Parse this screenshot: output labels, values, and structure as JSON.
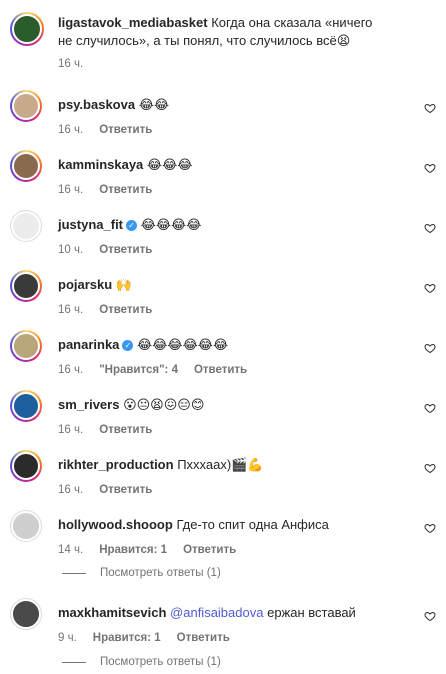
{
  "caption": {
    "username": "ligastavok_mediabasket",
    "text": "Когда она сказала «ничего не случилось», а ты понял, что случилось всё",
    "emoji": "😫",
    "time": "16 ч."
  },
  "comments": [
    {
      "username": "psy.baskova",
      "text": "",
      "emoji": "😂😂",
      "time": "16 ч.",
      "likes": "",
      "reply": "Ответить",
      "avatar_color": "#c9a98c"
    },
    {
      "username": "kamminskaya",
      "text": "",
      "emoji": "😂😂😂",
      "time": "16 ч.",
      "likes": "",
      "reply": "Ответить",
      "avatar_color": "#8a6a4e"
    },
    {
      "username": "justyna_fit",
      "text": "",
      "emoji": "😂😂😂😂",
      "time": "10 ч.",
      "likes": "",
      "reply": "Ответить",
      "avatar_color": "#ececec"
    },
    {
      "username": "pojarsku",
      "text": "",
      "emoji": "🙌",
      "time": "16 ч.",
      "likes": "",
      "reply": "Ответить",
      "avatar_color": "#3a3a3a"
    },
    {
      "username": "panarinka",
      "text": "",
      "emoji": "😂😂😂😂😂😂",
      "time": "16 ч.",
      "likes": "\"Нравится\": 4",
      "reply": "Ответить",
      "avatar_color": "#b8a57a"
    },
    {
      "username": "sm_rivers",
      "text": "",
      "emoji": "😮😐😫😖😑😊",
      "time": "16 ч.",
      "likes": "",
      "reply": "Ответить",
      "avatar_color": "#1d5f9c"
    },
    {
      "username": "rikhter_production",
      "text": "Пхххаах)",
      "emoji": "🎬💪",
      "time": "16 ч.",
      "likes": "",
      "reply": "Ответить",
      "avatar_color": "#2b2b2b"
    },
    {
      "username": "hollywood.shooop",
      "text": "Где-то спит одна Анфиса",
      "emoji": "",
      "time": "14 ч.",
      "likes": "Нравится: 1",
      "reply": "Ответить",
      "avatar_color": "#cfcfcf"
    },
    {
      "username": "maxkhamitsevich",
      "mention": "@anfisaibadova",
      "text": "ержан вставай",
      "emoji": "",
      "time": "9 ч.",
      "likes": "Нравится: 1",
      "reply": "Ответить",
      "avatar_color": "#4a4a4a"
    }
  ],
  "view_replies": [
    "Посмотреть ответы (1)",
    "Посмотреть ответы (1)"
  ]
}
